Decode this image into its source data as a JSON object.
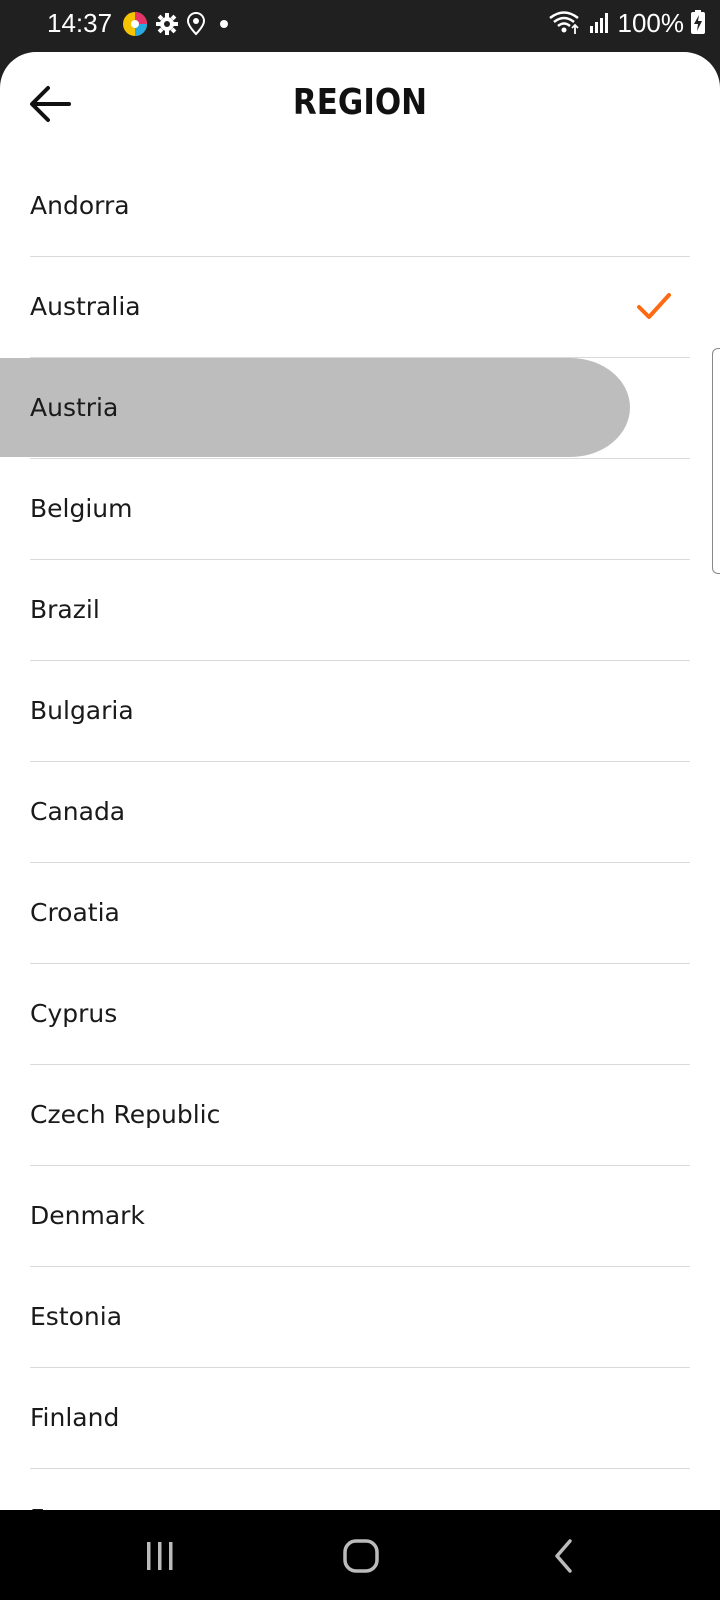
{
  "status_bar": {
    "time": "14:37",
    "battery": "100%",
    "left_icons": [
      "app-color-icon",
      "settings-icon",
      "location-icon",
      "dot-icon"
    ],
    "right_icons": [
      "wifi-icon",
      "signal-icon",
      "battery-charging-icon"
    ]
  },
  "header": {
    "title": "REGION",
    "back_icon": "arrow-left-icon"
  },
  "regions": [
    {
      "label": "Andorra",
      "selected": false,
      "pressed": false
    },
    {
      "label": "Australia",
      "selected": true,
      "pressed": false
    },
    {
      "label": "Austria",
      "selected": false,
      "pressed": true
    },
    {
      "label": "Belgium",
      "selected": false,
      "pressed": false
    },
    {
      "label": "Brazil",
      "selected": false,
      "pressed": false
    },
    {
      "label": "Bulgaria",
      "selected": false,
      "pressed": false
    },
    {
      "label": "Canada",
      "selected": false,
      "pressed": false
    },
    {
      "label": "Croatia",
      "selected": false,
      "pressed": false
    },
    {
      "label": "Cyprus",
      "selected": false,
      "pressed": false
    },
    {
      "label": "Czech Republic",
      "selected": false,
      "pressed": false
    },
    {
      "label": "Denmark",
      "selected": false,
      "pressed": false
    },
    {
      "label": "Estonia",
      "selected": false,
      "pressed": false
    },
    {
      "label": "Finland",
      "selected": false,
      "pressed": false
    },
    {
      "label": "F",
      "selected": false,
      "pressed": false
    }
  ],
  "colors": {
    "accent": "#ff6a13",
    "pressed": "#bdbdbd",
    "divider": "#dadada"
  },
  "nav_bar": {
    "icons": [
      "recent-apps-icon",
      "home-icon",
      "back-icon"
    ]
  }
}
